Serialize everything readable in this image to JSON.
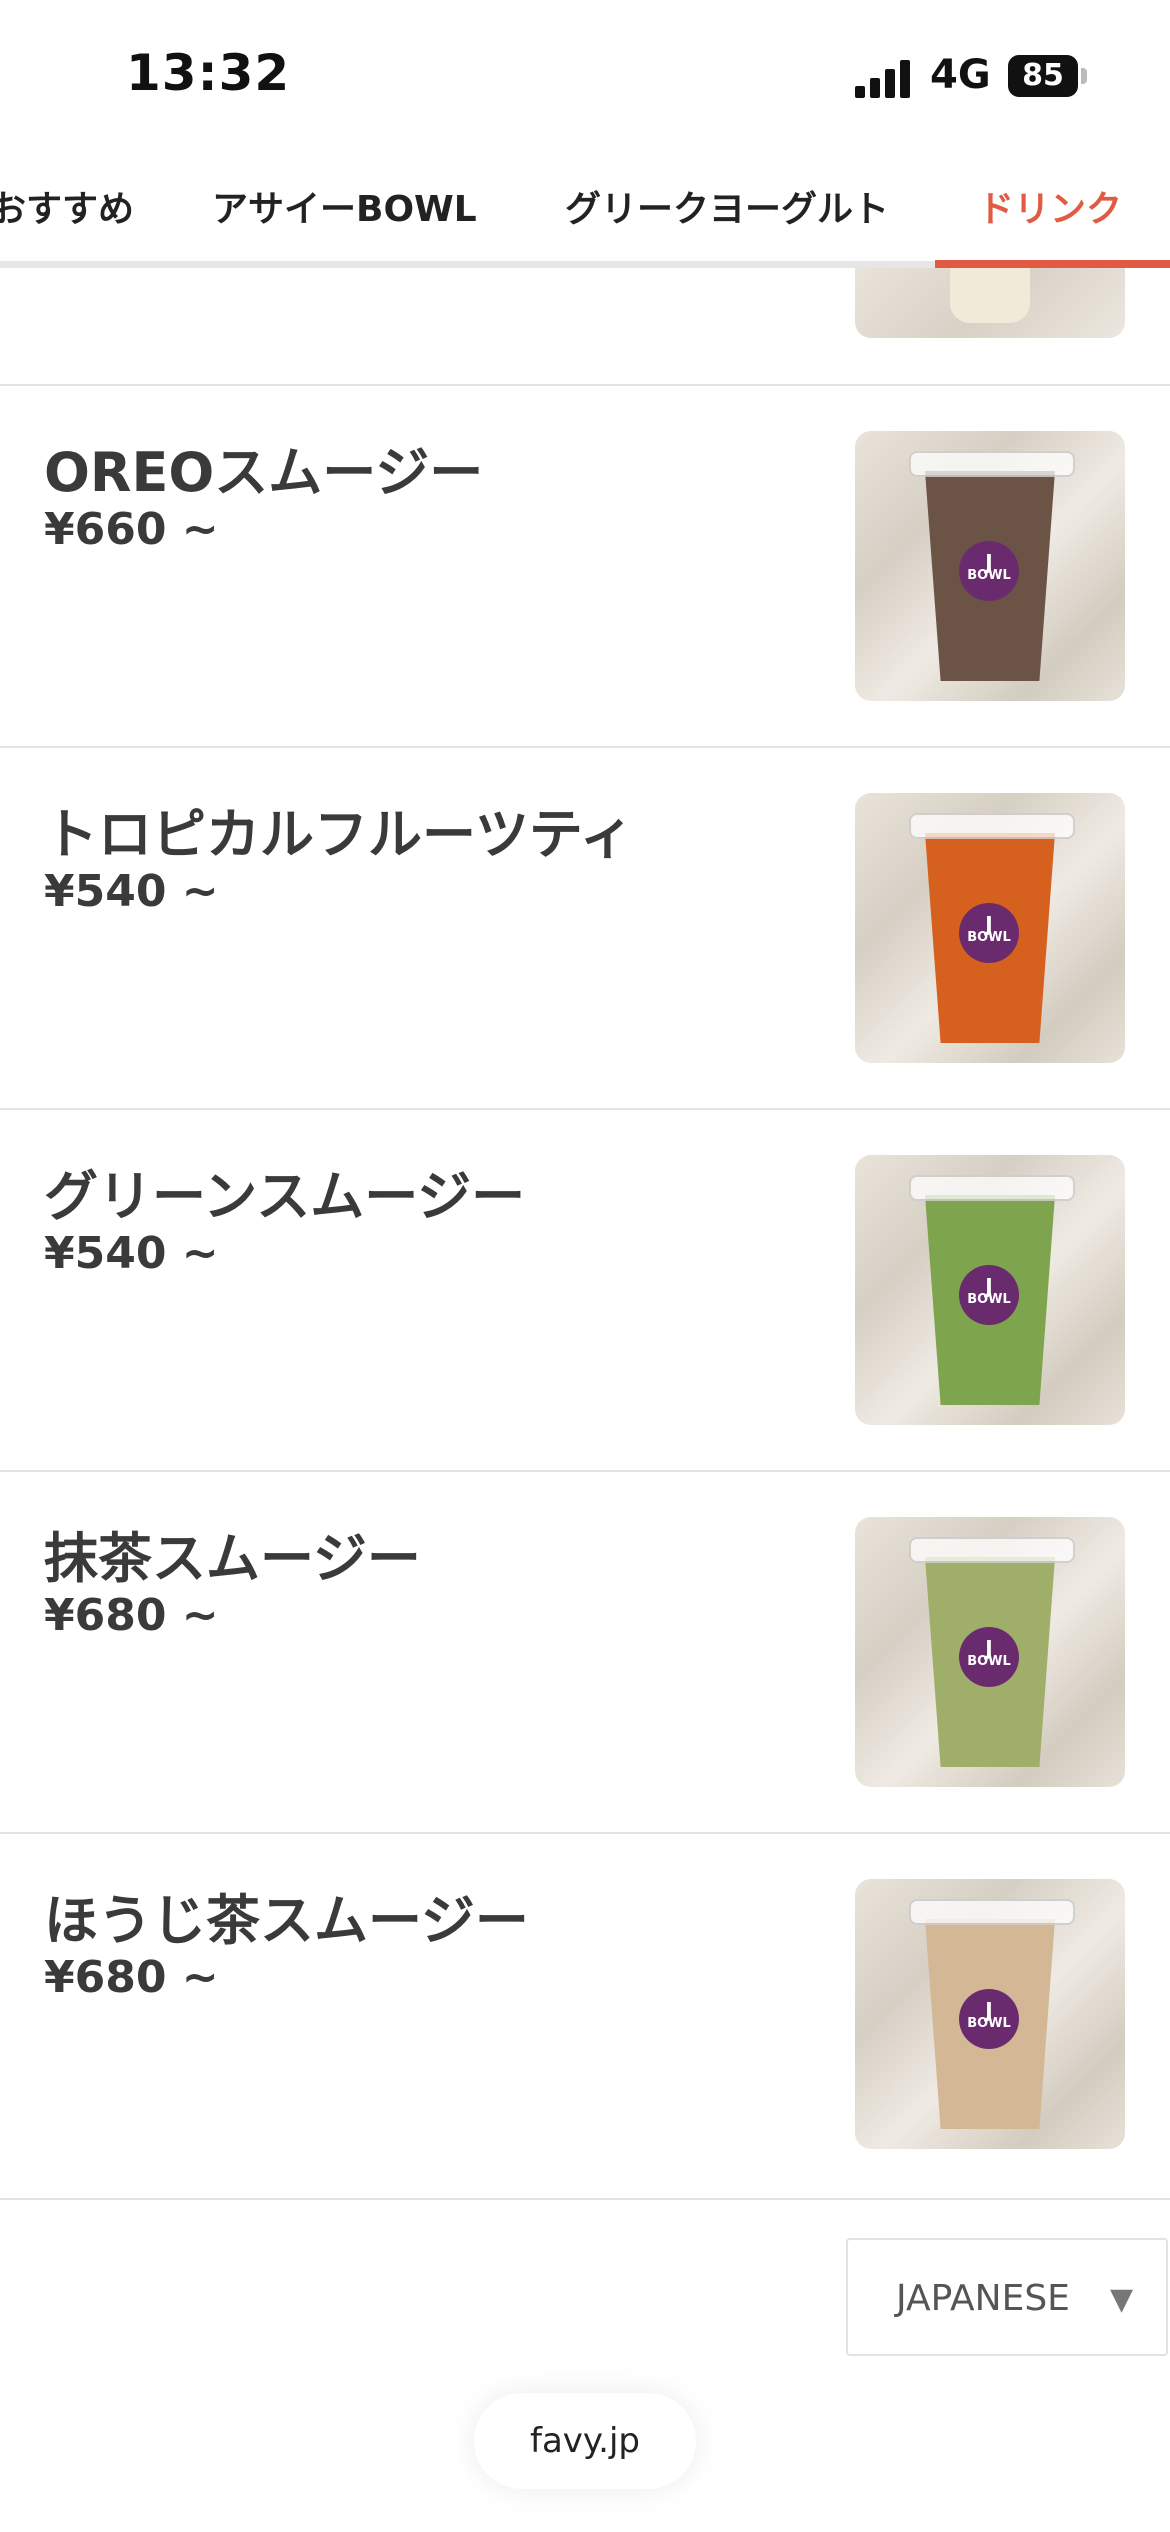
{
  "status_bar": {
    "time": "13:32",
    "network": "4G",
    "battery": "85"
  },
  "tabs": [
    {
      "label": "おすすめ"
    },
    {
      "label": "アサイーBOWL"
    },
    {
      "label": "グリークヨーグルト"
    },
    {
      "label": "ドリンク",
      "active": true
    }
  ],
  "menu_items": [
    {
      "name": "OREOスムージー",
      "price": "¥660 ~",
      "cup_color": "#6b5346"
    },
    {
      "name": "トロピカルフルーツティ",
      "price": "¥540 ~",
      "cup_color": "#d6611f"
    },
    {
      "name": "グリーンスムージー",
      "price": "¥540 ~",
      "cup_color": "#7ea44d"
    },
    {
      "name": "抹茶スムージー",
      "price": "¥680 ~",
      "cup_color": "#9fae69"
    },
    {
      "name": "ほうじ茶スムージー",
      "price": "¥680 ~",
      "cup_color": "#d4b896"
    }
  ],
  "logo_text": {
    "line1": "J",
    "line2": "BOWL"
  },
  "language": {
    "selected": "JAPANESE"
  },
  "footer": {
    "brand": "favy.jp"
  },
  "colors": {
    "accent": "#e05a44",
    "logo": "#6a2b6e"
  }
}
